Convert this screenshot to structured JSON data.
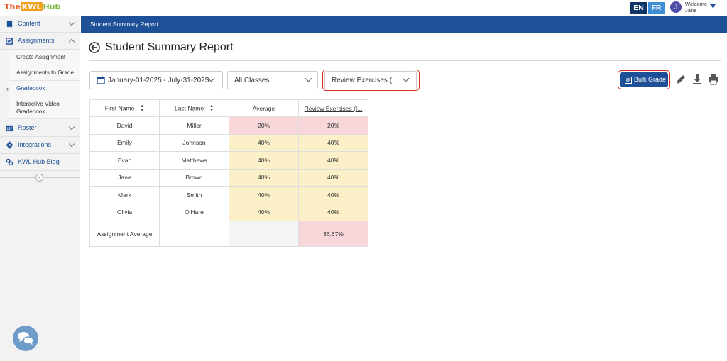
{
  "brand": {
    "the": "The",
    "kwl": "KWL",
    "hub": "Hub"
  },
  "header": {
    "lang_en": "EN",
    "lang_fr": "FR",
    "avatar_initial": "J",
    "welcome": "Welcome",
    "user_name": "Jane"
  },
  "sidebar": {
    "content": "Content",
    "assignments": "Assignments",
    "sub_items": [
      "Create Assignment",
      "Assignments to Grade",
      "Gradebook",
      "Interactive Video Gradebook"
    ],
    "roster": "Roster",
    "integrations": "Integrations",
    "blog": "KWL Hub Blog",
    "collapse": "«"
  },
  "breadcrumb": "Student Summary Report",
  "page_title": "Student Summary Report",
  "filters": {
    "date_range": "January-01-2025 - July-31-2025",
    "classes": "All Classes",
    "assignment": "Review Exercises (..."
  },
  "bulk_grade": "Bulk Grade",
  "table": {
    "headers": [
      "First Name",
      "Last Name",
      "Average",
      "Review Exercises (I..."
    ],
    "rows": [
      {
        "first": "David",
        "last": "Miller",
        "avg": "20%",
        "review": "20%",
        "level": "red"
      },
      {
        "first": "Emily",
        "last": "Johnson",
        "avg": "40%",
        "review": "40%",
        "level": "yellow"
      },
      {
        "first": "Evan",
        "last": "Matthews",
        "avg": "40%",
        "review": "40%",
        "level": "yellow"
      },
      {
        "first": "Jane",
        "last": "Brown",
        "avg": "40%",
        "review": "40%",
        "level": "yellow"
      },
      {
        "first": "Mark",
        "last": "Smith",
        "avg": "40%",
        "review": "40%",
        "level": "yellow"
      },
      {
        "first": "Olivia",
        "last": "O'Hare",
        "avg": "40%",
        "review": "40%",
        "level": "yellow"
      }
    ],
    "footer_label": "Assignment Average",
    "footer_review": "36.67%"
  },
  "colors": {
    "primary": "#1d5096",
    "low_score": "#f8d7da",
    "mid_score": "#fbf0c8",
    "highlight_outline": "#e0301e"
  },
  "icons": [
    "book-icon",
    "checkbox-icon",
    "calendar-icon",
    "gear-icon",
    "link-icon",
    "back-arrow-icon",
    "list-icon",
    "pencil-icon",
    "download-icon",
    "printer-icon",
    "chat-icon"
  ]
}
